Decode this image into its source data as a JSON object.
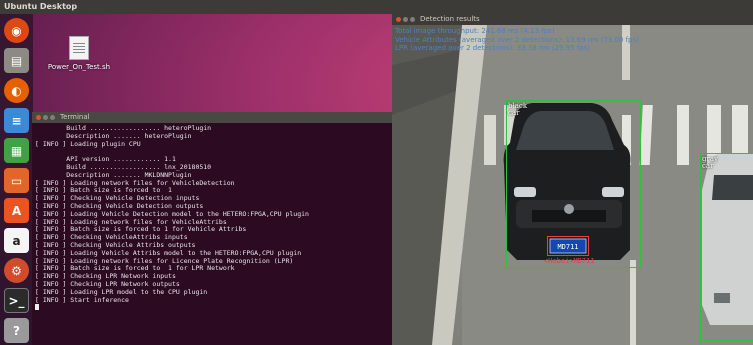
{
  "topbar": {
    "title": "Ubuntu Desktop"
  },
  "launcher": {
    "items": [
      {
        "icon": "ubuntu-dash-icon",
        "color": "#dd4814"
      },
      {
        "icon": "files-icon",
        "color": "#8d8a84"
      },
      {
        "icon": "firefox-icon",
        "color": "#e66000"
      },
      {
        "icon": "libreoffice-writer-icon",
        "color": "#3c8ad6"
      },
      {
        "icon": "libreoffice-calc-icon",
        "color": "#43a047"
      },
      {
        "icon": "libreoffice-impress-icon",
        "color": "#e0662c"
      },
      {
        "icon": "software-center-icon",
        "color": "#e95420"
      },
      {
        "icon": "amazon-icon",
        "color": "#f5f5f5"
      },
      {
        "icon": "system-settings-icon",
        "color": "#d24c2b"
      },
      {
        "icon": "terminal-icon",
        "color": "#2b2b2b"
      },
      {
        "icon": "help-icon",
        "color": "#9a9a9a"
      }
    ]
  },
  "desktop": {
    "file_label": "Power_On_Test.sh"
  },
  "terminal": {
    "title": "Terminal",
    "lines": [
      "        Build .................. heteroPlugin",
      "        Description ....... heteroPlugin",
      "[ INFO ] Loading plugin CPU",
      "",
      "        API version ............ 1.1",
      "        Build .................. lnx_20180510",
      "        Description ....... MKLDNNPlugin",
      "[ INFO ] Loading network files for VehicleDetection",
      "[ INFO ] Batch size is forced to  1",
      "[ INFO ] Checking Vehicle Detection inputs",
      "[ INFO ] Checking Vehicle Detection outputs",
      "[ INFO ] Loading Vehicle Detection model to the HETERO:FPGA,CPU plugin",
      "[ INFO ] Loading network files for VehicleAttribs",
      "[ INFO ] Batch size is forced to 1 for Vehicle Attribs",
      "[ INFO ] Checking VehicleAttribs inputs",
      "[ INFO ] Checking Vehicle Attribs outputs",
      "[ INFO ] Loading Vehicle Attribs model to the HETERO:FPGA,CPU plugin",
      "[ INFO ] Loading network files for Licence Plate Recognition (LPR)",
      "[ INFO ] Batch size is forced to  1 for LPR Network",
      "[ INFO ] Checking LPR Network inputs",
      "[ INFO ] Checking LPR Network outputs",
      "[ INFO ] Loading LPR model to the CPU plugin",
      "[ INFO ] Start inference"
    ]
  },
  "detection": {
    "title": "Detection results",
    "stats": [
      "Total image throughput: 241.68 ms (4.13 fps)",
      "Vehicle Attributes (averaged over 2 detections): 13.69 ms (73.00 fps)",
      "LPR (averaged over 2 detections): 33.38 ms (29.95 fps)"
    ],
    "labels": {
      "car1_color": "black",
      "car1_type": "car",
      "car2_color": "gray",
      "car2_type": "car",
      "plate": "<Hebei>MD711",
      "plate_display": "MD711"
    },
    "box_color": "#2dc23a",
    "plate_color": "#e84040"
  }
}
